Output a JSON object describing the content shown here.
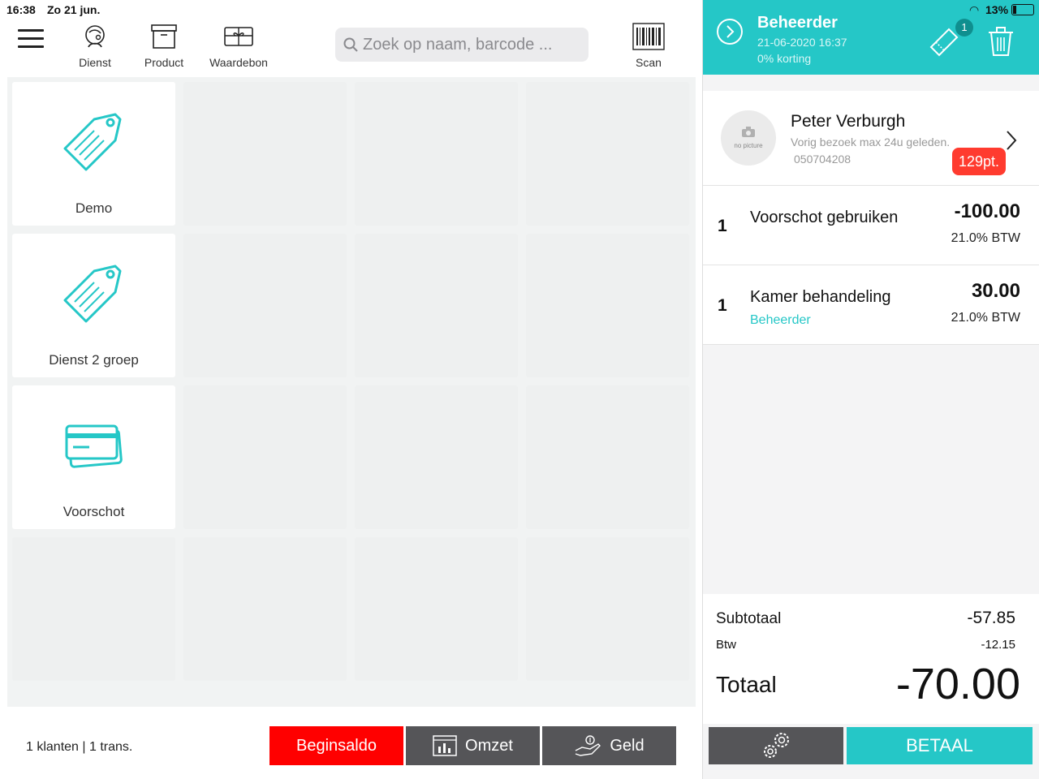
{
  "status_bar": {
    "time": "16:38",
    "date": "Zo 21 jun.",
    "battery": "13%"
  },
  "toolbar": {
    "dienst_label": "Dienst",
    "product_label": "Product",
    "waardebon_label": "Waardebon",
    "scan_label": "Scan"
  },
  "search": {
    "placeholder": "Zoek op naam, barcode ..."
  },
  "tiles": [
    {
      "label": "Demo",
      "icon": "tag-icon"
    },
    {
      "label": "Dienst 2 groep",
      "icon": "tag-icon"
    },
    {
      "label": "Voorschot",
      "icon": "credit-card-icon"
    }
  ],
  "footer": {
    "summary": "1 klanten | 1 trans.",
    "beginsaldo_label": "Beginsaldo",
    "omzet_label": "Omzet",
    "geld_label": "Geld"
  },
  "header": {
    "title": "Beheerder",
    "datetime": "21-06-2020 16:37",
    "discount": "0% korting",
    "ticket_badge": "1"
  },
  "customer": {
    "name": "Peter Verburgh",
    "subtitle": "Vorig bezoek max 24u geleden.",
    "phone": "050704208",
    "points": "129pt.",
    "avatar_text": "no picture"
  },
  "lines": [
    {
      "qty": "1",
      "description": "Voorschot gebruiken",
      "price": "-100.00",
      "btw": "21.0% BTW",
      "staff": ""
    },
    {
      "qty": "1",
      "description": "Kamer behandeling",
      "price": "30.00",
      "btw": "21.0% BTW",
      "staff": "Beheerder"
    }
  ],
  "totals": {
    "subtotal_label": "Subtotaal",
    "subtotal_value": "-57.85",
    "btw_label": "Btw",
    "btw_value": "-12.15",
    "total_label": "Totaal",
    "total_value": "-70.00"
  },
  "actions": {
    "pay_label": "BETAAL"
  },
  "colors": {
    "accent": "#25c7c7",
    "danger": "#ff0000",
    "points_badge": "#ff3b2f",
    "dark_button": "#555558"
  }
}
